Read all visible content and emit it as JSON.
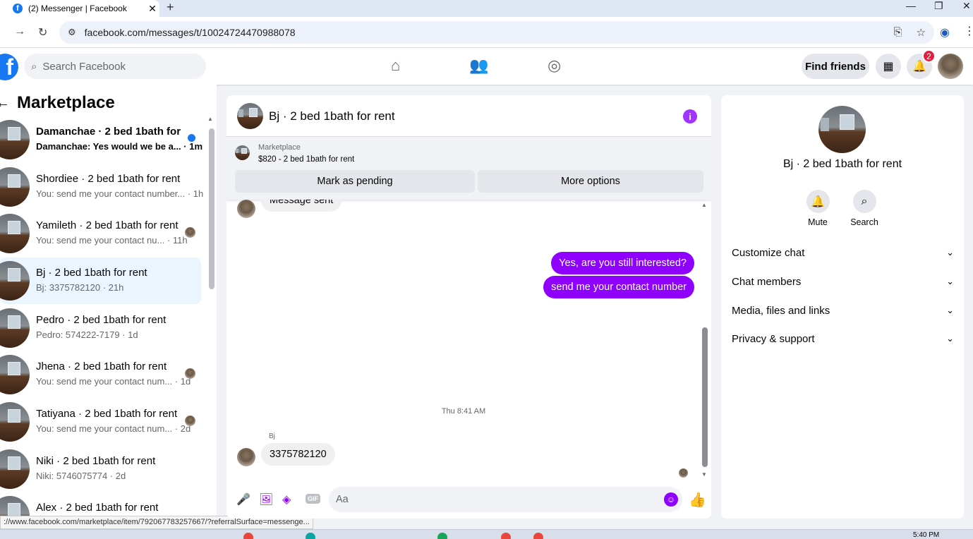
{
  "browser": {
    "tab_title": "(2) Messenger | Facebook",
    "tab_close": "✕",
    "new_tab": "+",
    "url": "facebook.com/messages/t/10024724470988078",
    "status_url": "://www.facebook.com/marketplace/item/792067783257667/?referralSurface=messenge..."
  },
  "header": {
    "search_placeholder": "Search Facebook",
    "find_friends": "Find friends",
    "notification_count": "2"
  },
  "left": {
    "title": "Marketplace",
    "conversations": [
      {
        "name": "Damanchae · 2 bed 1bath for r...",
        "preview": "Damanchae: Yes would we be a... · 1m",
        "unread": true
      },
      {
        "name": "Shordiee · 2 bed 1bath for rent",
        "preview": "You: send me your contact number... · 1h"
      },
      {
        "name": "Yamileth · 2 bed 1bath for rent",
        "preview": "You: send me your contact nu...  · 11h"
      },
      {
        "name": "Bj · 2 bed 1bath for rent",
        "preview": "Bj: 3375782120 · 21h",
        "active": true
      },
      {
        "name": "Pedro · 2 bed 1bath for rent",
        "preview": "Pedro: 574222-7179 · 1d"
      },
      {
        "name": "Jhena · 2 bed 1bath for rent",
        "preview": "You: send me your contact num...  · 1d"
      },
      {
        "name": "Tatiyana · 2 bed 1bath for rent",
        "preview": "You: send me your contact num...  · 2d"
      },
      {
        "name": "Niki · 2 bed 1bath for rent",
        "preview": "Niki: 5746075774 · 2d"
      },
      {
        "name": "Alex · 2 bed 1bath for rent",
        "preview": ""
      }
    ]
  },
  "chat": {
    "title": "Bj · 2 bed 1bath for rent",
    "marketplace_label": "Marketplace",
    "listing": "$820 - 2 bed 1bath for rent",
    "mark_pending": "Mark as pending",
    "more_options": "More options",
    "message_partial": "Message sent",
    "outgoing": [
      "Yes, are you still interested?",
      "send me your contact number"
    ],
    "timestamp": "Thu 8:41 AM",
    "sender_name": "Bj",
    "incoming": "3375782120",
    "composer_placeholder": "Aa",
    "gif_label": "GIF"
  },
  "right": {
    "name": "Bj · 2 bed 1bath for rent",
    "actions": [
      "Mute",
      "Search"
    ],
    "sections": [
      "Customize chat",
      "Chat members",
      "Media, files and links",
      "Privacy & support"
    ]
  },
  "taskbar": {
    "time": "5:40 PM"
  },
  "colors": {
    "accent": "#8f00ff",
    "fb_blue": "#1877f2",
    "badge_red": "#e41e3f"
  }
}
